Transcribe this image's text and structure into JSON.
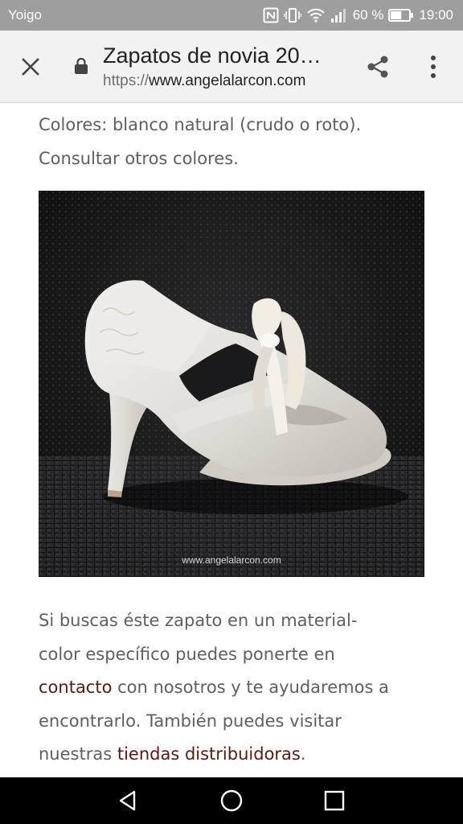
{
  "status_bar": {
    "carrier": "Yoigo",
    "battery_percent": "60 %",
    "battery_level": 0.6,
    "time": "19:00",
    "icons": [
      "nfc-icon",
      "vibrate-icon",
      "wifi-icon",
      "signal-icon",
      "battery-icon"
    ]
  },
  "toolbar": {
    "title": "Zapatos de novia 20…",
    "url_scheme": "https://",
    "url_host": "www.angelalarcon.com",
    "icons": [
      "close-icon",
      "lock-icon",
      "share-icon",
      "more-vert-icon"
    ]
  },
  "content": {
    "colors_text_1": "Colores: blanco natural (crudo o roto).",
    "colors_text_2": "Consultar otros colores.",
    "watermark": "www.angelalarcon.com",
    "info_text_1": "Si buscas éste zapato en un material-",
    "info_text_2": "color específico puedes ponerte en",
    "contact_link": "contacto",
    "info_text_3": " con nosotros y te ayudaremos a",
    "info_text_4": "encontrarlo. También puedes visitar",
    "info_text_5": "nuestras ",
    "stores_link": "tiendas distribuidoras",
    "info_text_6": ".",
    "link_color": "#5c1a0e"
  },
  "nav_bar": {
    "icons": [
      "back-icon",
      "home-icon",
      "recents-icon"
    ]
  }
}
